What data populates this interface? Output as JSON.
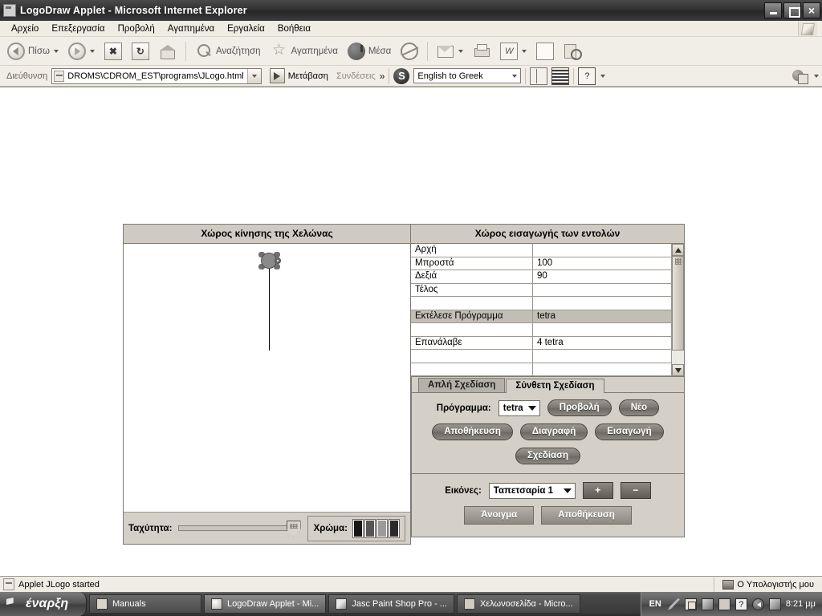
{
  "window": {
    "title": "LogoDraw Applet - Microsoft Internet Explorer",
    "icon": "ie-document-icon",
    "minimize_label": "",
    "maximize_label": "",
    "close_label": "×"
  },
  "menu": {
    "items": [
      {
        "label": "Αρχείο"
      },
      {
        "label": "Επεξεργασία"
      },
      {
        "label": "Προβολή"
      },
      {
        "label": "Αγαπημένα"
      },
      {
        "label": "Εργαλεία"
      },
      {
        "label": "Βοήθεια"
      }
    ]
  },
  "toolbar": {
    "back_label": "Πίσω",
    "forward_label": "",
    "stop_label": "",
    "refresh_label": "",
    "home_label": "",
    "search_label": "Αναζήτηση",
    "favorites_label": "Αγαπημένα",
    "media_label": "Μέσα",
    "history_label": "",
    "mail_label": "",
    "print_label": "",
    "word_label": "",
    "page_label": "",
    "edit_label": ""
  },
  "address_bar": {
    "label": "Διεύθυνση",
    "value": "DROMS\\CDROM_EST\\programs\\JLogo.html",
    "go_label": "Μετάβαση",
    "links_label": "Συνδέσεις",
    "overflow_label": "»"
  },
  "translate_bar": {
    "selected": "English to Greek",
    "options": [
      "English to Greek"
    ]
  },
  "applet": {
    "turtle_panel": {
      "title": "Χώρος κίνησης της Χελώνας",
      "speed_label": "Ταχύτητα:",
      "color_label": "Χρώμα:",
      "color_swatches": [
        "#161616",
        "#555555",
        "#9b9b9b",
        "#2a2a2a"
      ]
    },
    "commands_panel": {
      "title": "Χώρος εισαγωγής των εντολών",
      "rows": [
        {
          "command": "Αρχή",
          "value": "",
          "selected": false
        },
        {
          "command": "Μπροστά",
          "value": "100",
          "selected": false
        },
        {
          "command": "Δεξιά",
          "value": "90",
          "selected": false
        },
        {
          "command": "Τέλος",
          "value": "",
          "selected": false
        },
        {
          "command": "",
          "value": "",
          "selected": false
        },
        {
          "command": "Εκτέλεσε Πρόγραμμα",
          "value": "tetra",
          "selected": true
        },
        {
          "command": "",
          "value": "",
          "selected": false
        },
        {
          "command": "Επανάλαβε",
          "value": "4 tetra",
          "selected": false
        },
        {
          "command": "",
          "value": "",
          "selected": false
        },
        {
          "command": "",
          "value": "",
          "selected": false
        }
      ]
    },
    "tabs": [
      {
        "label": "Απλή Σχεδίαση",
        "active": false
      },
      {
        "label": "Σύνθετη Σχεδίαση",
        "active": true
      }
    ],
    "program_row": {
      "label": "Πρόγραμμα:",
      "selected": "tetra",
      "options": [
        "tetra"
      ],
      "preview_button": "Προβολή",
      "new_button": "Νέο"
    },
    "action_buttons": {
      "save": "Αποθήκευση",
      "delete": "Διαγραφή",
      "insert": "Εισαγωγή",
      "draw": "Σχεδίαση"
    },
    "images_row": {
      "label": "Εικόνες:",
      "selected": "Ταπετσαρία 1",
      "options": [
        "Ταπετσαρία 1"
      ],
      "plus": "+",
      "minus": "−",
      "open_button": "Άνοιγμα",
      "save_button": "Αποθήκευση"
    }
  },
  "status_bar": {
    "text": "Applet JLogo started",
    "zone": "Ο Υπολογιστής μου"
  },
  "taskbar": {
    "start_label": "έναρξη",
    "tasks": [
      {
        "label": "Manuals",
        "active": false
      },
      {
        "label": "LogoDraw Applet - Mi...",
        "active": true
      },
      {
        "label": "Jasc Paint Shop Pro - ...",
        "active": false
      },
      {
        "label": "Χελωνοσελίδα - Micro...",
        "active": false
      }
    ],
    "tray": {
      "language": "EN",
      "clock": "8:21 μμ"
    }
  }
}
